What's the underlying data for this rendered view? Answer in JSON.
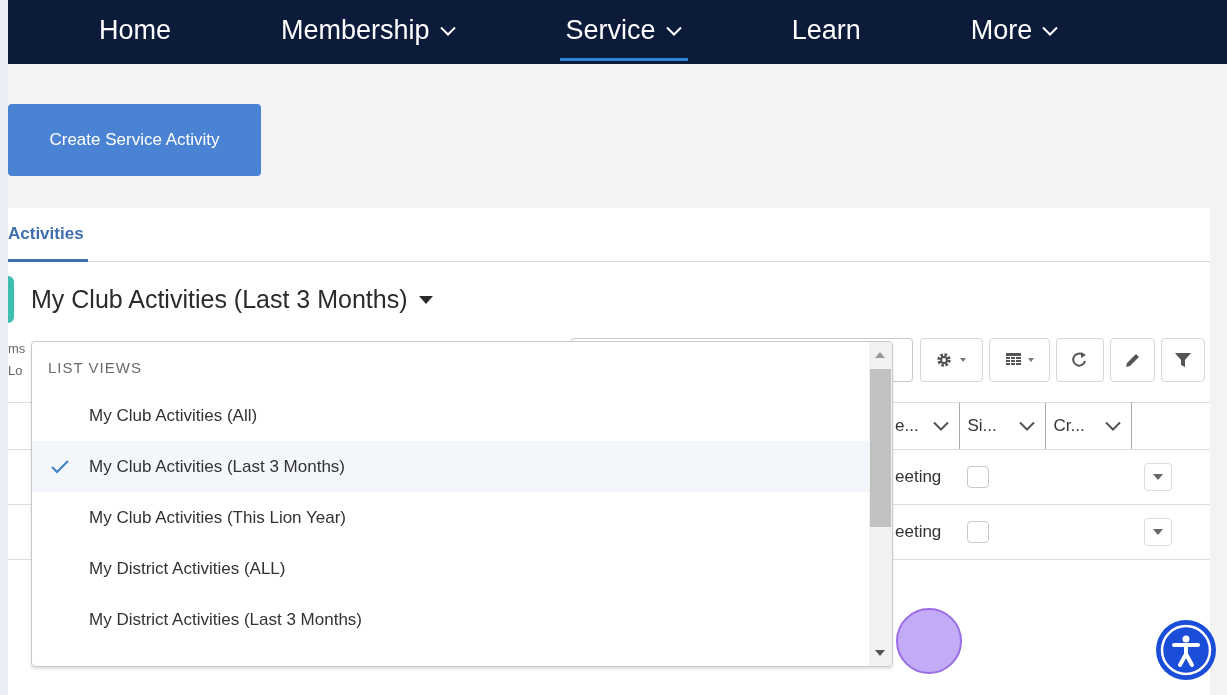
{
  "nav": {
    "items": [
      {
        "label": "Home",
        "has_menu": false,
        "selected": false
      },
      {
        "label": "Membership",
        "has_menu": true,
        "selected": false
      },
      {
        "label": "Service",
        "has_menu": true,
        "selected": true
      },
      {
        "label": "Learn",
        "has_menu": false,
        "selected": false
      },
      {
        "label": "More",
        "has_menu": true,
        "selected": false
      }
    ]
  },
  "create_button": {
    "label": "Create Service Activity"
  },
  "tabs": [
    {
      "label": "Activities",
      "selected": true
    }
  ],
  "list_view": {
    "title": "My Club Activities (Last 3 Months)",
    "meta_lines": [
      "ms",
      "Lo"
    ]
  },
  "table": {
    "columns": [
      {
        "label": "e..."
      },
      {
        "label": "Si..."
      },
      {
        "label": "Cr..."
      }
    ],
    "rows": [
      {
        "column_1": "eeting",
        "checked": false
      },
      {
        "column_1": "eeting",
        "checked": false
      }
    ]
  },
  "dropdown": {
    "header": "LIST VIEWS",
    "items": [
      {
        "label": "My Club Activities (All)",
        "selected": false
      },
      {
        "label": "My Club Activities (Last 3 Months)",
        "selected": true
      },
      {
        "label": "My Club Activities (This Lion Year)",
        "selected": false
      },
      {
        "label": "My District Activities (ALL)",
        "selected": false
      },
      {
        "label": "My District Activities (Last 3 Months)",
        "selected": false
      }
    ]
  }
}
